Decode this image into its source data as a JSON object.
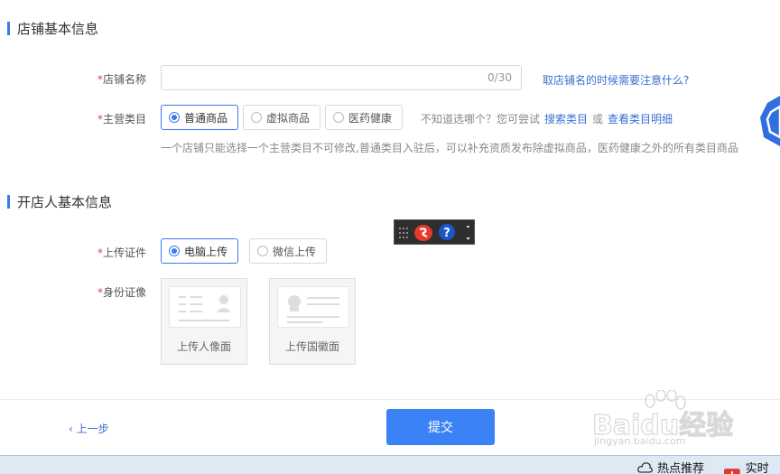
{
  "shop_info": {
    "title": "店铺基本信息",
    "name_label": "店铺名称",
    "name_value": "",
    "name_count": "0/30",
    "name_tip_link": "取店铺名的时候需要注意什么?",
    "category_label": "主营类目",
    "categories": [
      {
        "label": "普通商品",
        "selected": true
      },
      {
        "label": "虚拟商品",
        "selected": false
      },
      {
        "label": "医药健康",
        "selected": false
      }
    ],
    "category_hint": "不知道选哪个？您可尝试",
    "search_link": "搜索类目",
    "or_text": "或",
    "detail_link": "查看类目明细",
    "category_note": "一个店铺只能选择一个主营类目不可修改,普通类目入驻后，可以补充资质发布除虚拟商品，医药健康之外的所有类目商品"
  },
  "owner_info": {
    "title": "开店人基本信息",
    "upload_label": "上传证件",
    "upload_methods": [
      {
        "label": "电脑上传",
        "selected": true
      },
      {
        "label": "微信上传",
        "selected": false
      }
    ],
    "id_label": "身份证像",
    "portrait_caption": "上传人像面",
    "emblem_caption": "上传国徽面"
  },
  "required_mark": "*",
  "footer": {
    "prev_label": "上一步",
    "submit_label": "提交"
  },
  "taskbar": {
    "hot_label": "热点推荐",
    "realtime_label": "实时热"
  },
  "watermark": {
    "main": "Baidu经验",
    "sub": "jingyan.baidu.com"
  },
  "colors": {
    "accent": "#3a7bf0",
    "submit": "#3b82f6",
    "required": "#e54040",
    "link": "#3b6fd1"
  }
}
